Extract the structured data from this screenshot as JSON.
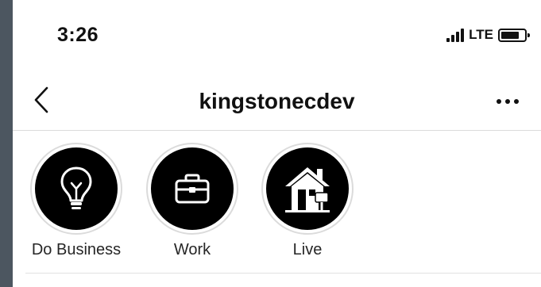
{
  "status_bar": {
    "time": "3:26",
    "network": "LTE"
  },
  "nav": {
    "title": "kingstonecdev",
    "back_icon": "chevron-left-icon",
    "more_icon": "more-horizontal-icon"
  },
  "highlights": [
    {
      "label": "Do Business",
      "icon": "lightbulb-icon"
    },
    {
      "label": "Work",
      "icon": "briefcase-icon"
    },
    {
      "label": "Live",
      "icon": "house-icon"
    }
  ],
  "colors": {
    "background": "#4c5660",
    "surface": "#ffffff",
    "text": "#111111",
    "divider": "#dbdbdb",
    "highlight_disc": "#000000"
  }
}
